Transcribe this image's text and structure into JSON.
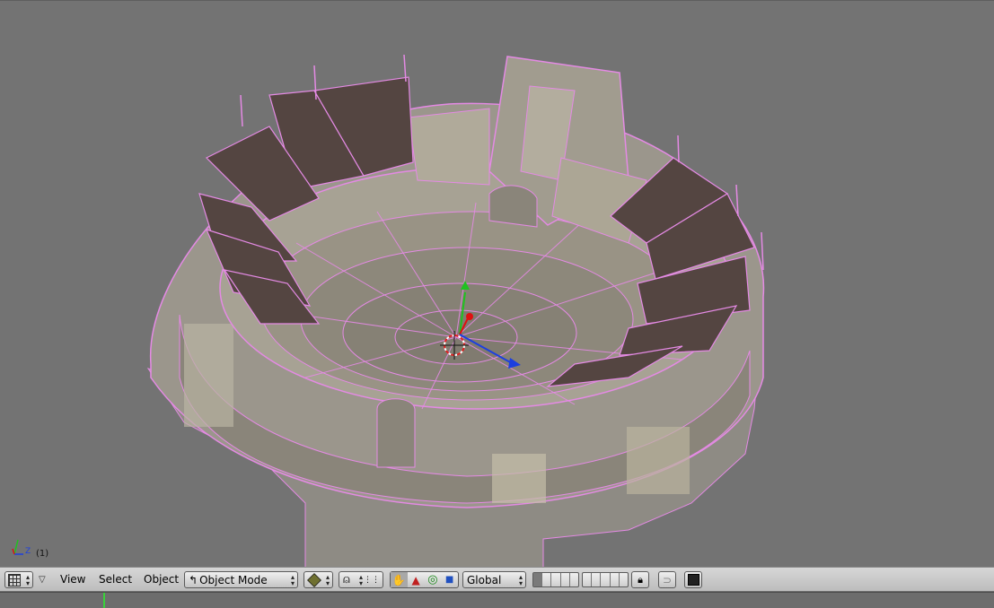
{
  "viewport": {
    "frame_label": "(1)",
    "axis_label": "Z"
  },
  "header": {
    "menus": [
      "View",
      "Select",
      "Object"
    ],
    "mode_select": "Object Mode",
    "orientation_select": "Global"
  },
  "colors": {
    "viewport_bg": "#737373",
    "wire_selected": "#ff80ff",
    "header_bg": "#c8c8c8",
    "timeline_bg": "#6d6d6d",
    "frame_marker": "#3ad13a"
  }
}
